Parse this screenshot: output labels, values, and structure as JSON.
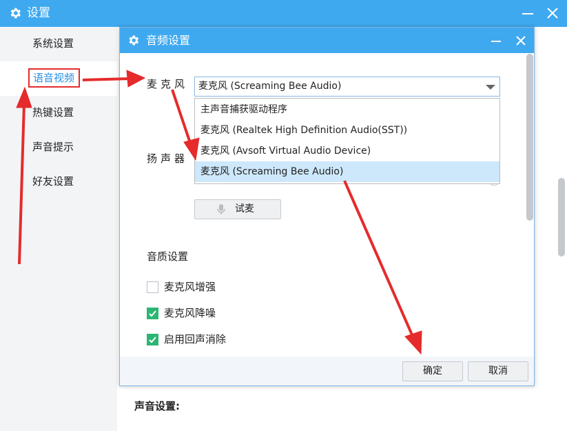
{
  "window": {
    "title": "设置",
    "controls": [
      "minimize-icon",
      "close-icon"
    ]
  },
  "sidebar": {
    "items": [
      {
        "label": "系统设置",
        "active": false
      },
      {
        "label": "语音视频",
        "active": true
      },
      {
        "label": "热键设置",
        "active": false
      },
      {
        "label": "声音提示",
        "active": false
      },
      {
        "label": "好友设置",
        "active": false
      }
    ],
    "highlight_color": "#e52b2b"
  },
  "main": {
    "sound_settings_label": "声音设置:"
  },
  "dialog": {
    "title": "音频设置",
    "microphone": {
      "label": "麦克风",
      "selected": "麦克风 (Screaming Bee Audio)",
      "options": [
        "主声音捕获驱动程序",
        "麦克风 (Realtek High Definition Audio(SST))",
        "麦克风 (Avsoft Virtual Audio Device)",
        "麦克风 (Screaming Bee Audio)"
      ],
      "highlighted_option_index": 3
    },
    "speaker": {
      "label": "扬声器"
    },
    "test_mic_button": "试麦",
    "quality_section": {
      "title": "音质设置",
      "options": [
        {
          "label": "麦克风增强",
          "checked": false
        },
        {
          "label": "麦克风降噪",
          "checked": true
        },
        {
          "label": "启用回声消除",
          "checked": true
        }
      ]
    },
    "buttons": {
      "confirm": "确定",
      "cancel": "取消"
    }
  },
  "colors": {
    "titlebar": "#3fa9f0",
    "active_nav_text": "#2b8fe0",
    "checkbox_checked": "#2bb673",
    "annotation_arrow": "#e52b2b",
    "dropdown_highlight": "#cde8fb"
  }
}
